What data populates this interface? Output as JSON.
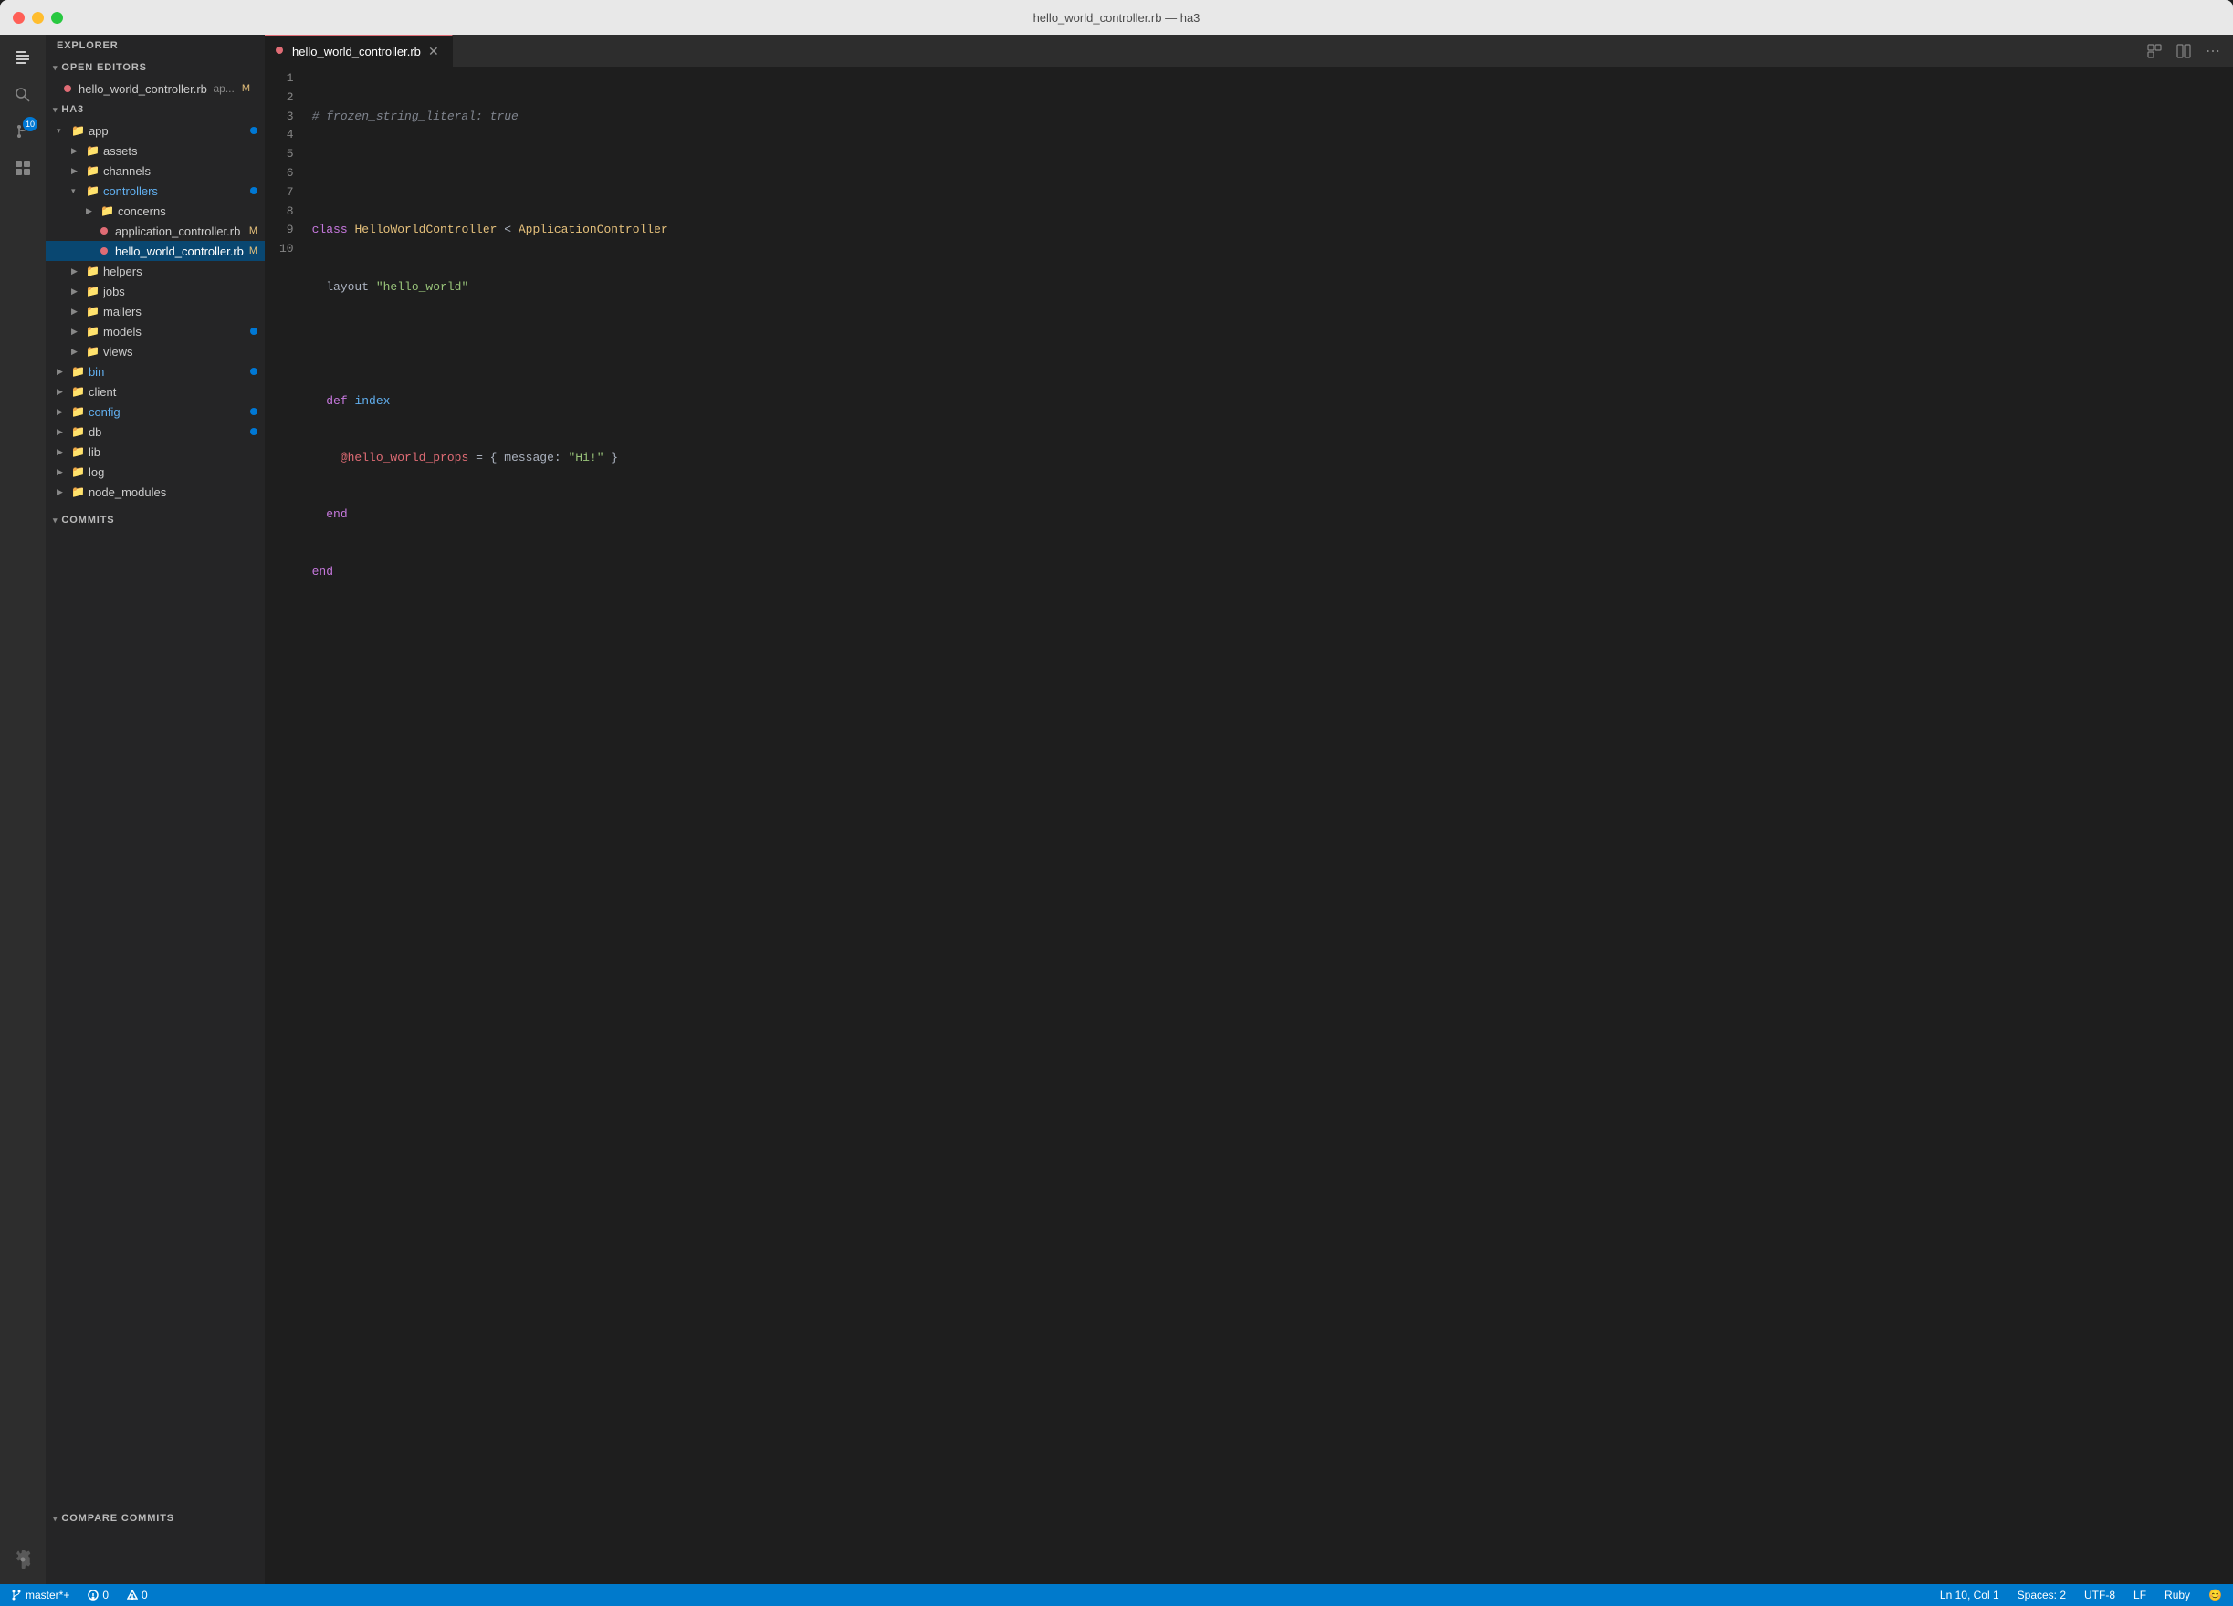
{
  "window": {
    "title": "hello_world_controller.rb — ha3"
  },
  "titlebar": {
    "title": "hello_world_controller.rb — ha3"
  },
  "activity_bar": {
    "icons": [
      {
        "name": "explorer-icon",
        "symbol": "⎘",
        "active": true,
        "badge": null
      },
      {
        "name": "search-icon",
        "symbol": "🔍",
        "active": false,
        "badge": null
      },
      {
        "name": "source-control-icon",
        "symbol": "⑂",
        "active": false,
        "badge": "10"
      },
      {
        "name": "extensions-icon",
        "symbol": "⊞",
        "active": false,
        "badge": null
      }
    ],
    "bottom_icons": [
      {
        "name": "settings-icon",
        "symbol": "⚙"
      }
    ]
  },
  "sidebar": {
    "explorer_label": "EXPLORER",
    "open_editors_label": "OPEN EDITORS",
    "open_editors_files": [
      {
        "name": "hello_world_controller.rb",
        "short": "ap...",
        "badge": "M"
      }
    ],
    "project_name": "HA3",
    "tree": [
      {
        "type": "folder",
        "label": "app",
        "level": 1,
        "open": true,
        "dot": true
      },
      {
        "type": "folder",
        "label": "assets",
        "level": 2,
        "open": false,
        "dot": false
      },
      {
        "type": "folder",
        "label": "channels",
        "level": 2,
        "open": false,
        "dot": false
      },
      {
        "type": "folder",
        "label": "controllers",
        "level": 2,
        "open": true,
        "dot": true,
        "color": "#61afef"
      },
      {
        "type": "folder",
        "label": "concerns",
        "level": 3,
        "open": false,
        "dot": false
      },
      {
        "type": "file",
        "label": "application_controller.rb",
        "level": 3,
        "badge": "M"
      },
      {
        "type": "file",
        "label": "hello_world_controller.rb",
        "level": 3,
        "badge": "M",
        "selected": true
      },
      {
        "type": "folder",
        "label": "helpers",
        "level": 2,
        "open": false,
        "dot": false
      },
      {
        "type": "folder",
        "label": "jobs",
        "level": 2,
        "open": false,
        "dot": false
      },
      {
        "type": "folder",
        "label": "mailers",
        "level": 2,
        "open": false,
        "dot": false
      },
      {
        "type": "folder",
        "label": "models",
        "level": 2,
        "open": false,
        "dot": true
      },
      {
        "type": "folder",
        "label": "views",
        "level": 2,
        "open": false,
        "dot": false
      },
      {
        "type": "folder",
        "label": "bin",
        "level": 1,
        "open": false,
        "dot": true,
        "color": "#61afef"
      },
      {
        "type": "folder",
        "label": "client",
        "level": 1,
        "open": false,
        "dot": false
      },
      {
        "type": "folder",
        "label": "config",
        "level": 1,
        "open": false,
        "dot": true,
        "color": "#61afef"
      },
      {
        "type": "folder",
        "label": "db",
        "level": 1,
        "open": false,
        "dot": true
      },
      {
        "type": "folder",
        "label": "lib",
        "level": 1,
        "open": false,
        "dot": false
      },
      {
        "type": "folder",
        "label": "log",
        "level": 1,
        "open": false,
        "dot": false
      },
      {
        "type": "folder",
        "label": "node_modules",
        "level": 1,
        "open": false,
        "dot": false
      }
    ],
    "commits_label": "COMMITS",
    "compare_commits_label": "COMPARE COMMITS"
  },
  "tabs": [
    {
      "label": "hello_world_controller.rb",
      "active": true,
      "modified": false
    }
  ],
  "tab_actions": [
    {
      "name": "open-editors-icon",
      "symbol": "⊡"
    },
    {
      "name": "split-editor-icon",
      "symbol": "⧉"
    },
    {
      "name": "more-actions-icon",
      "symbol": "⋯"
    }
  ],
  "code": {
    "lines": [
      {
        "num": 1,
        "tokens": [
          {
            "cls": "c-comment",
            "text": "# frozen_string_literal: true"
          }
        ]
      },
      {
        "num": 2,
        "tokens": []
      },
      {
        "num": 3,
        "tokens": [
          {
            "cls": "c-keyword",
            "text": "class"
          },
          {
            "cls": "c-plain",
            "text": " "
          },
          {
            "cls": "c-class",
            "text": "HelloWorldController"
          },
          {
            "cls": "c-plain",
            "text": " < "
          },
          {
            "cls": "c-superclass",
            "text": "ApplicationController"
          }
        ]
      },
      {
        "num": 4,
        "tokens": [
          {
            "cls": "c-plain",
            "text": "  layout "
          },
          {
            "cls": "c-string",
            "text": "\"hello_world\""
          }
        ]
      },
      {
        "num": 5,
        "tokens": []
      },
      {
        "num": 6,
        "tokens": [
          {
            "cls": "c-plain",
            "text": "  "
          },
          {
            "cls": "c-keyword",
            "text": "def"
          },
          {
            "cls": "c-plain",
            "text": " "
          },
          {
            "cls": "c-method",
            "text": "index"
          }
        ]
      },
      {
        "num": 7,
        "tokens": [
          {
            "cls": "c-plain",
            "text": "    "
          },
          {
            "cls": "c-ivar",
            "text": "@hello_world_props"
          },
          {
            "cls": "c-plain",
            "text": " = { message: "
          },
          {
            "cls": "c-string",
            "text": "\"Hi!\""
          },
          {
            "cls": "c-plain",
            "text": " }"
          }
        ]
      },
      {
        "num": 8,
        "tokens": [
          {
            "cls": "c-plain",
            "text": "  "
          },
          {
            "cls": "c-keyword",
            "text": "end"
          }
        ]
      },
      {
        "num": 9,
        "tokens": [
          {
            "cls": "c-keyword",
            "text": "end"
          }
        ]
      },
      {
        "num": 10,
        "tokens": []
      }
    ]
  },
  "status_bar": {
    "branch": "master*+",
    "errors": "0",
    "warnings": "0",
    "position": "Ln 10, Col 1",
    "spaces": "Spaces: 2",
    "encoding": "UTF-8",
    "line_ending": "LF",
    "language": "Ruby",
    "smiley": "😊"
  }
}
